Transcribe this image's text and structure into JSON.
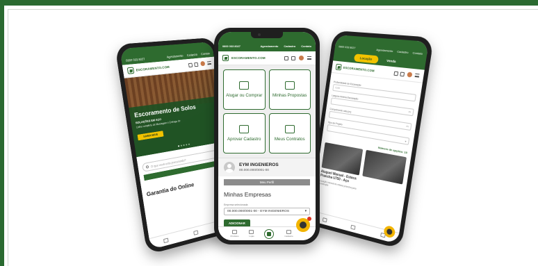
{
  "left_phone": {
    "topbar": {
      "phone_number": "0800 033 8027",
      "links": [
        "Agendamento",
        "Cadastro",
        "Contato"
      ]
    },
    "logo_text": "ESCORAMENTO.COM",
    "hero": {
      "title": "Escoramento de Solos",
      "subtitle": "SOLUÇÕES EM AÇO",
      "description": "Linha completa de Montagem e Entrega de",
      "button_label": "SAIBA MAIS"
    },
    "search_placeholder": "O que você está procurando?",
    "section_title": "Garantia do Online"
  },
  "center_phone": {
    "topbar": {
      "phone_number": "0800 033 8027",
      "links": [
        "Agendamento",
        "Cadastro",
        "Contato"
      ]
    },
    "logo_text": "ESCORAMENTO.COM",
    "cards": [
      {
        "label": "Alugar ou Comprar",
        "icon": "laptop-icon"
      },
      {
        "label": "Minhas Propostas",
        "icon": "document-icon"
      },
      {
        "label": "Aprovar Cadastro",
        "icon": "thumbs-up-icon"
      },
      {
        "label": "Meus Contratos",
        "icon": "contract-icon"
      }
    ],
    "profile": {
      "name": "EYM INGENIEROS",
      "cnpj": "00.000.000/0001-00",
      "button_label": "Meu Perfil"
    },
    "empresas": {
      "title": "Minhas Empresas",
      "select_label": "Empresa selecionada",
      "selected_value": "00.000.000/0001-00 - EYM INGENIEROS",
      "add_button_label": "ADICIONAR"
    },
    "bottom_nav": [
      "Produtos",
      "Lojas",
      "",
      "Cadastro",
      ""
    ]
  },
  "right_phone": {
    "topbar": {
      "phone_number": "0800 033 8027",
      "links": [
        "Agendamento",
        "Cadastro",
        "Contato"
      ]
    },
    "toggle": {
      "active": "Locação",
      "inactive": "Venda"
    },
    "logo_text": "ESCORAMENTO.COM",
    "form": {
      "field1_label": "Profundidade de Escavação",
      "field1_value": "0,00",
      "field2_label": "Largura minima Escavação",
      "field2_value": "m",
      "field3_label": "Comprimento vala (m)",
      "field3_value": "m",
      "field4_label": "Tipo de Projeto",
      "field4_value": ""
    },
    "result_count": "Número de opções: 10",
    "products": [
      {
        "name": "Aluguel Manual - Estaca Prancha U750 - Aço",
        "desc": "Locação mensal de estaca prancha para contenção"
      },
      {
        "name": "",
        "desc": ""
      }
    ]
  }
}
